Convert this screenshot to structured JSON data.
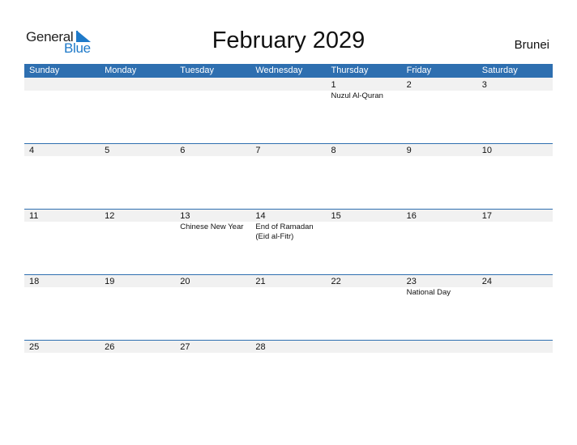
{
  "logo": {
    "general": "General",
    "blue": "Blue",
    "icon": "triangle-flag-icon"
  },
  "title": "February 2029",
  "country": "Brunei",
  "colors": {
    "header_bg": "#2e6fb0",
    "band_bg": "#f1f1f1",
    "logo_blue": "#1f7ac9"
  },
  "weekdays": [
    "Sunday",
    "Monday",
    "Tuesday",
    "Wednesday",
    "Thursday",
    "Friday",
    "Saturday"
  ],
  "weeks": [
    [
      {
        "day": "",
        "events": []
      },
      {
        "day": "",
        "events": []
      },
      {
        "day": "",
        "events": []
      },
      {
        "day": "",
        "events": []
      },
      {
        "day": "1",
        "events": [
          "Nuzul Al-Quran"
        ]
      },
      {
        "day": "2",
        "events": []
      },
      {
        "day": "3",
        "events": []
      }
    ],
    [
      {
        "day": "4",
        "events": []
      },
      {
        "day": "5",
        "events": []
      },
      {
        "day": "6",
        "events": []
      },
      {
        "day": "7",
        "events": []
      },
      {
        "day": "8",
        "events": []
      },
      {
        "day": "9",
        "events": []
      },
      {
        "day": "10",
        "events": []
      }
    ],
    [
      {
        "day": "11",
        "events": []
      },
      {
        "day": "12",
        "events": []
      },
      {
        "day": "13",
        "events": [
          "Chinese New Year"
        ]
      },
      {
        "day": "14",
        "events": [
          "End of Ramadan",
          "(Eid al-Fitr)"
        ]
      },
      {
        "day": "15",
        "events": []
      },
      {
        "day": "16",
        "events": []
      },
      {
        "day": "17",
        "events": []
      }
    ],
    [
      {
        "day": "18",
        "events": []
      },
      {
        "day": "19",
        "events": []
      },
      {
        "day": "20",
        "events": []
      },
      {
        "day": "21",
        "events": []
      },
      {
        "day": "22",
        "events": []
      },
      {
        "day": "23",
        "events": [
          "National Day"
        ]
      },
      {
        "day": "24",
        "events": []
      }
    ],
    [
      {
        "day": "25",
        "events": []
      },
      {
        "day": "26",
        "events": []
      },
      {
        "day": "27",
        "events": []
      },
      {
        "day": "28",
        "events": []
      },
      {
        "day": "",
        "events": []
      },
      {
        "day": "",
        "events": []
      },
      {
        "day": "",
        "events": []
      }
    ]
  ]
}
